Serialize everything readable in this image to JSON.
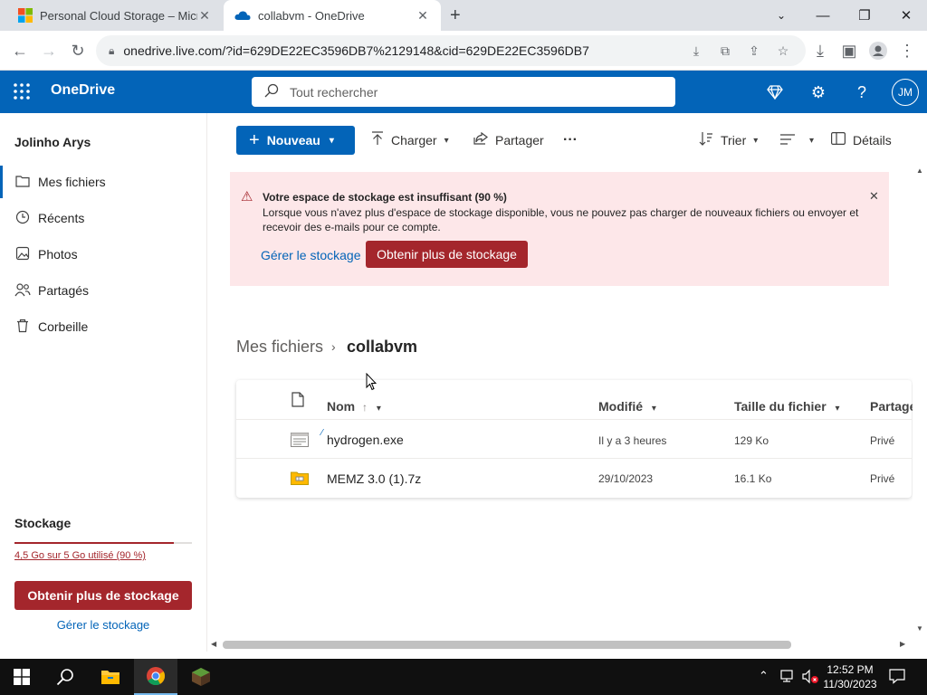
{
  "browser": {
    "tabs": [
      {
        "title": "Personal Cloud Storage – Microsoft",
        "icon": "microsoft-logo-icon"
      },
      {
        "title": "collabvm - OneDrive",
        "icon": "onedrive-cloud-icon"
      }
    ],
    "new_tab": "+",
    "url": "onedrive.live.com/?id=629DE22EC3596DB7%2129148&cid=629DE22EC3596DB7"
  },
  "header": {
    "app_name": "OneDrive",
    "search_placeholder": "Tout rechercher",
    "avatar_initials": "JM"
  },
  "sidebar": {
    "user_name": "Jolinho Arys",
    "items": [
      {
        "label": "Mes fichiers",
        "icon": "folder-icon",
        "selected": true
      },
      {
        "label": "Récents",
        "icon": "clock-icon"
      },
      {
        "label": "Photos",
        "icon": "image-icon"
      },
      {
        "label": "Partagés",
        "icon": "people-icon"
      },
      {
        "label": "Corbeille",
        "icon": "trash-icon"
      }
    ],
    "storage_heading": "Stockage",
    "storage_used_text": "4,5 Go sur 5 Go utilisé (90 %)",
    "storage_fraction": 0.9,
    "get_more_label": "Obtenir plus de stockage",
    "manage_label": "Gérer le stockage"
  },
  "commands": {
    "new": "Nouveau",
    "upload": "Charger",
    "share": "Partager",
    "more": "···",
    "sort": "Trier",
    "details": "Détails"
  },
  "banner": {
    "title": "Votre espace de stockage est insuffisant (90 %)",
    "body": "Lorsque vous n'avez plus d'espace de stockage disponible, vous ne pouvez pas charger de nouveaux fichiers ou envoyer et recevoir des e-mails pour ce compte.",
    "manage_label": "Gérer le stockage",
    "get_more_label": "Obtenir plus de stockage"
  },
  "breadcrumb": {
    "root": "Mes fichiers",
    "separator": "›",
    "current": "collabvm"
  },
  "table": {
    "columns": {
      "name": "Nom",
      "modified": "Modifié",
      "size": "Taille du fichier",
      "sharing": "Partage"
    },
    "sort_indicator": "↑",
    "rows": [
      {
        "name": "hydrogen.exe",
        "modified": "Il y a 3 heures",
        "size": "129 Ko",
        "sharing": "Privé",
        "icon": "exe-file-icon"
      },
      {
        "name": "MEMZ 3.0 (1).7z",
        "modified": "29/10/2023",
        "size": "16.1 Ko",
        "sharing": "Privé",
        "icon": "archive-file-icon"
      }
    ]
  },
  "taskbar": {
    "time": "12:52 PM",
    "date": "11/30/2023"
  },
  "colors": {
    "onedrive_blue": "#0364b8",
    "alert_red": "#a4262c",
    "banner_bg": "#fde7e9"
  }
}
